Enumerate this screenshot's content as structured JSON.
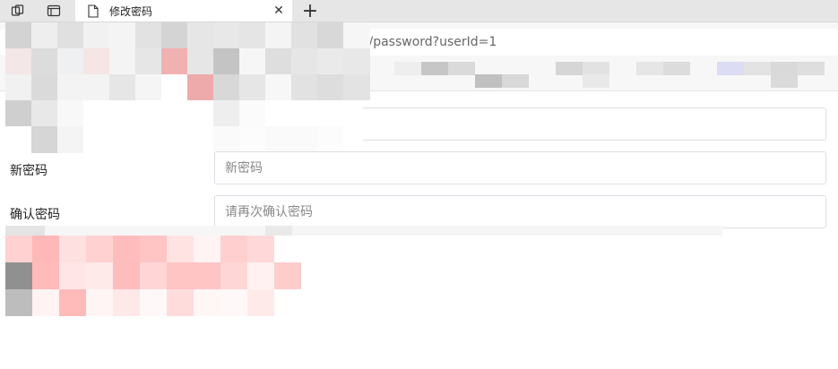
{
  "browser": {
    "tab": {
      "title": "修改密码"
    },
    "address_bar": {
      "visible_url": "fo/password?userId=1"
    }
  },
  "form": {
    "new_password": {
      "label": "新密码",
      "placeholder": "新密码"
    },
    "confirm_password": {
      "label": "确认密码",
      "placeholder": "请再次确认密码"
    }
  },
  "colors": {
    "tabstrip": "#e6e6e6",
    "input_border": "#dcdfe6",
    "placeholder": "#888888"
  }
}
